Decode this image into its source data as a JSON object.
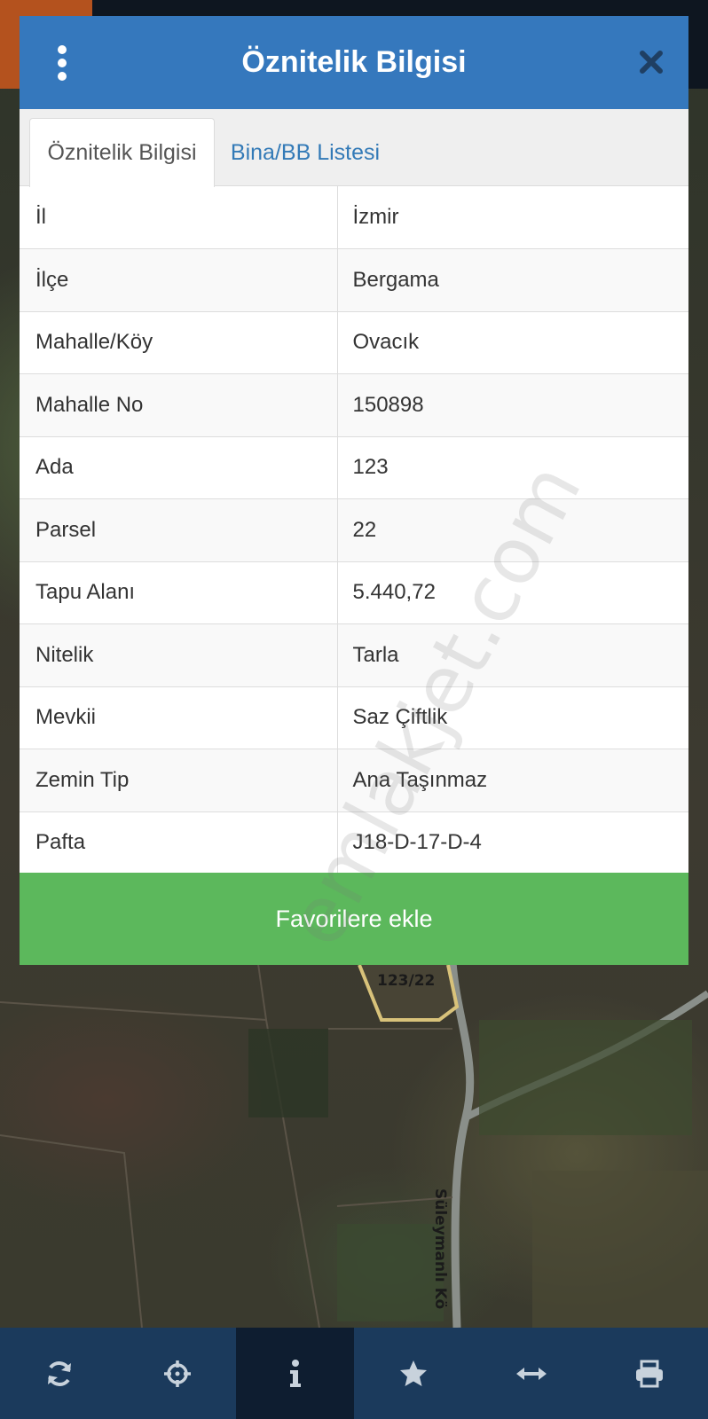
{
  "dialog": {
    "title": "Öznitelik Bilgisi",
    "tabs": [
      {
        "label": "Öznitelik Bilgisi",
        "active": true
      },
      {
        "label": "Bina/BB Listesi",
        "active": false
      }
    ],
    "rows": [
      {
        "key": "İl",
        "value": "İzmir"
      },
      {
        "key": "İlçe",
        "value": "Bergama"
      },
      {
        "key": "Mahalle/Köy",
        "value": "Ovacık"
      },
      {
        "key": "Mahalle No",
        "value": "150898"
      },
      {
        "key": "Ada",
        "value": "123"
      },
      {
        "key": "Parsel",
        "value": "22"
      },
      {
        "key": "Tapu Alanı",
        "value": "5.440,72"
      },
      {
        "key": "Nitelik",
        "value": "Tarla"
      },
      {
        "key": "Mevkii",
        "value": "Saz Çiftlik"
      },
      {
        "key": "Zemin Tip",
        "value": "Ana Taşınmaz"
      },
      {
        "key": "Pafta",
        "value": "J18-D-17-D-4"
      }
    ],
    "favorite_button": "Favorilere ekle",
    "icons": {
      "menu": "menu-dots-icon",
      "close": "close-icon"
    }
  },
  "watermark": "emlakjet.com",
  "map": {
    "parcel_label": "123/22",
    "road_label": "Süleymanlı Kö"
  },
  "toolbar": {
    "items": [
      {
        "icon": "refresh-icon",
        "active": false
      },
      {
        "icon": "locate-icon",
        "active": false
      },
      {
        "icon": "info-icon",
        "active": true
      },
      {
        "icon": "star-icon",
        "active": false
      },
      {
        "icon": "measure-icon",
        "active": false
      },
      {
        "icon": "print-icon",
        "active": false
      }
    ]
  },
  "colors": {
    "header": "#3578bd",
    "tab_link": "#337ab7",
    "button": "#5cb85c",
    "toolbar": "#1b3a5c",
    "toolbar_active": "#0e1d30"
  }
}
